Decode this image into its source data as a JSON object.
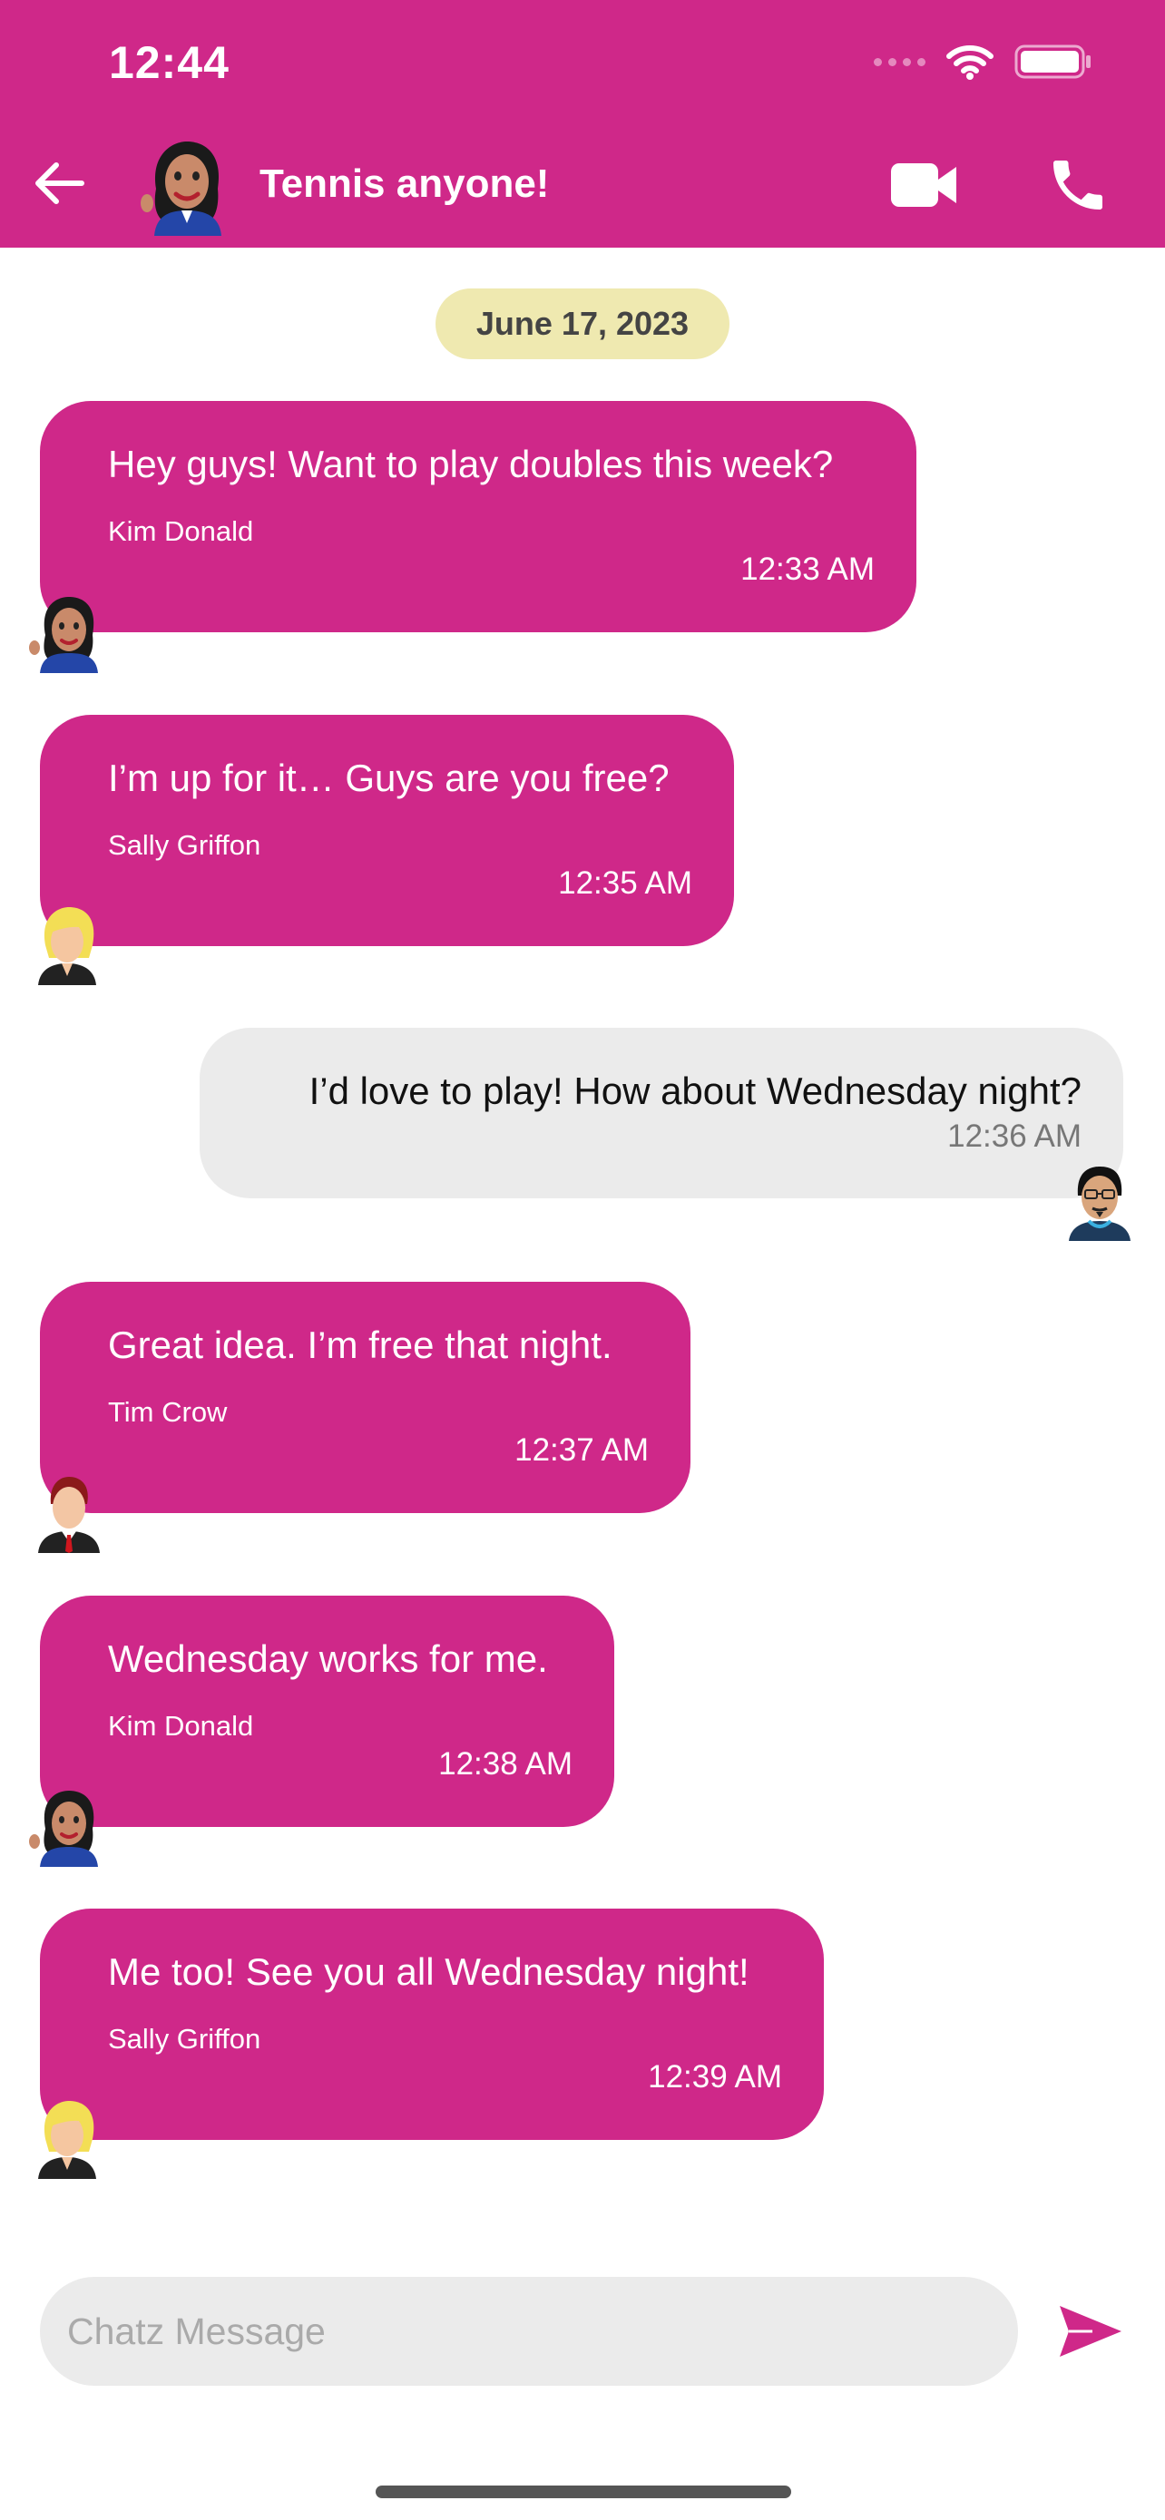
{
  "status": {
    "time": "12:44"
  },
  "header": {
    "title": "Tennis anyone!"
  },
  "date_pill": "June 17, 2023",
  "messages": [
    {
      "text": "Hey guys! Want to play doubles this week?",
      "sender": "Kim Donald",
      "time": "12:33 AM"
    },
    {
      "text": "I’m up for it… Guys are you free?",
      "sender": "Sally Griffon",
      "time": "12:35 AM"
    },
    {
      "text": "I’d love to play! How about Wednesday night?",
      "time": "12:36 AM"
    },
    {
      "text": "Great idea. I’m free that night.",
      "sender": "Tim Crow",
      "time": "12:37 AM"
    },
    {
      "text": "Wednesday works for me.",
      "sender": "Kim Donald",
      "time": "12:38 AM"
    },
    {
      "text": "Me too! See you all Wednesday night!",
      "sender": "Sally Griffon",
      "time": "12:39 AM"
    }
  ],
  "composer": {
    "placeholder": "Chatz Message"
  },
  "icons": {
    "back": "arrow-left-icon",
    "video": "video-camera-icon",
    "call": "phone-icon",
    "send": "send-icon",
    "wifi": "wifi-icon",
    "battery": "battery-icon"
  },
  "colors": {
    "accent": "#CF2889",
    "incoming_bubble": "#CF2889",
    "outgoing_bubble": "#EBEBEB",
    "date_pill": "#EFE9B0"
  }
}
